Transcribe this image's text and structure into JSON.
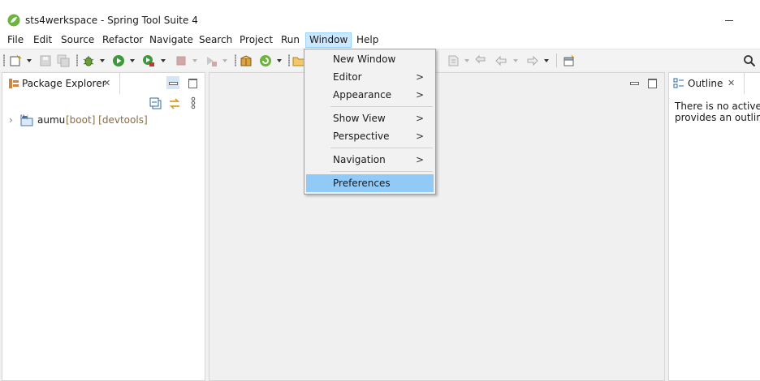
{
  "window": {
    "title": "sts4werkspace - Spring Tool Suite 4"
  },
  "menubar": {
    "items": [
      "File",
      "Edit",
      "Source",
      "Refactor",
      "Navigate",
      "Search",
      "Project",
      "Run",
      "Window",
      "Help"
    ],
    "active": "Window"
  },
  "window_menu": {
    "items": [
      {
        "label": "New Window",
        "submenu": false
      },
      {
        "label": "Editor",
        "submenu": true
      },
      {
        "label": "Appearance",
        "submenu": true
      },
      {
        "label": "Show View",
        "submenu": true
      },
      {
        "label": "Perspective",
        "submenu": true
      },
      {
        "label": "Navigation",
        "submenu": true
      },
      {
        "label": "Preferences",
        "submenu": false
      }
    ],
    "selected": "Preferences",
    "submenu_arrow": ">"
  },
  "package_explorer": {
    "tab_label": "Package Explorer",
    "project": {
      "name": "aumu",
      "decoration": "[boot] [devtools]"
    }
  },
  "outline": {
    "tab_label": "Outline",
    "message_line1": "There is no active e",
    "message_line2": "provides an outline."
  },
  "icons": {
    "close": "close-icon",
    "minimize": "minimize-icon",
    "maximize": "maximize-icon",
    "search": "search-icon"
  },
  "colors": {
    "menu_active_bg": "#cce8ff",
    "menu_selected_bg": "#91c9f7",
    "spring_green": "#6db33f",
    "decoration_text": "#8a6d3b"
  }
}
